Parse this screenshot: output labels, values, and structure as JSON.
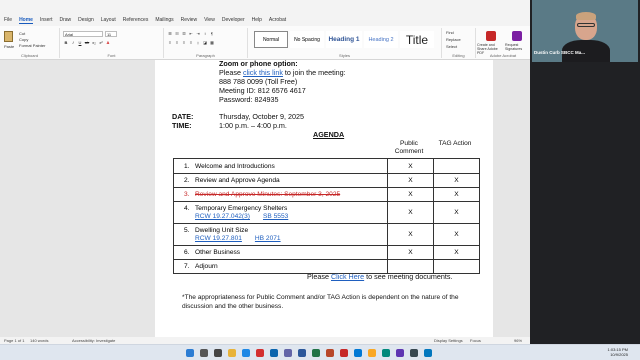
{
  "menu": {
    "tabs": [
      "File",
      "Home",
      "Insert",
      "Draw",
      "Design",
      "Layout",
      "References",
      "Mailings",
      "Review",
      "View",
      "Developer",
      "Help",
      "Acrobat"
    ],
    "active": "Home"
  },
  "ribbon": {
    "clipboard": {
      "paste": "Paste",
      "cut": "Cut",
      "copy": "Copy",
      "format_painter": "Format Painter",
      "label": "Clipboard"
    },
    "font": {
      "name": "Arial",
      "size": "11",
      "label": "Font"
    },
    "paragraph": {
      "label": "Paragraph"
    },
    "styles": {
      "items": [
        "Normal",
        "No Spacing",
        "Heading 1",
        "Heading 2",
        "Title"
      ],
      "label": "Styles"
    },
    "editing": {
      "find": "Find",
      "replace": "Replace",
      "select": "Select",
      "label": "Editing"
    },
    "acrobat": {
      "create": "Create and Share Adobe PDF",
      "request": "Request Signatures",
      "label": "Adobe Acrobat"
    }
  },
  "document": {
    "zoom_heading": "Zoom or phone option:",
    "join_prefix": "Please ",
    "join_link": "click this link",
    "join_suffix": " to join the meeting:",
    "phone": "888 788 0099 (Toll Free)",
    "meeting_id": "Meeting ID: 812 6576 4617",
    "password": "Password: 824935",
    "date_label": "DATE:",
    "date_value": "Thursday, October 9, 2025",
    "time_label": "TIME:",
    "time_value": "1:00 p.m. – 4:00 p.m.",
    "agenda_title": "AGENDA",
    "col_public": "Public Comment",
    "col_tag": "TAG Action",
    "items": [
      {
        "num": "1.",
        "text": "Welcome and Introductions",
        "public": "X",
        "tag": ""
      },
      {
        "num": "2.",
        "text": "Review and Approve Agenda",
        "public": "X",
        "tag": "X"
      },
      {
        "num": "3.",
        "text": "Review and Approve Minutes: September 3, 2025",
        "public": "X",
        "tag": "X"
      },
      {
        "num": "4.",
        "text": "Temporary Emergency Shelters",
        "links": [
          "RCW 19.27.042(3)",
          "SB 5553"
        ],
        "public": "X",
        "tag": "X"
      },
      {
        "num": "5.",
        "text": "Dwelling Unit Size",
        "links": [
          "RCW 19.27.801",
          "HB 2071"
        ],
        "public": "X",
        "tag": "X"
      },
      {
        "num": "6.",
        "text": "Other Business",
        "public": "X",
        "tag": "X"
      },
      {
        "num": "7.",
        "text": "Adjourn",
        "public": "",
        "tag": ""
      }
    ],
    "docs_prefix": "Please ",
    "docs_link": "Click Here",
    "docs_suffix": " to see meeting documents.",
    "footnote": "*The appropriateness for Public Comment and/or TAG Action is dependent on the nature of the discussion and the other business."
  },
  "status": {
    "page": "Page 1 of 1",
    "words": "140 words",
    "accessibility": "Accessibility: Investigate",
    "display": "Display Settings",
    "focus": "Focus",
    "zoom": "96%"
  },
  "taskbar": {
    "time": "1:03:15 PM",
    "date": "10/9/2025"
  },
  "video": {
    "participant": "Dustin Curb SBCC Ma..."
  }
}
